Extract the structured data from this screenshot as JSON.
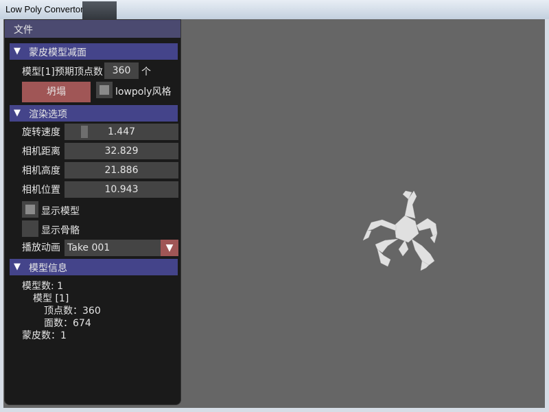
{
  "window": {
    "title": "Low Poly Convertor"
  },
  "menu": {
    "file": "文件"
  },
  "section_reduce": {
    "header": "蒙皮模型减面",
    "target_label": "模型[1]预期顶点数",
    "target_value": "360",
    "target_unit": "个",
    "collapse_button": "坍塌",
    "lowpoly_label": "lowpoly风格",
    "lowpoly_checked": true
  },
  "section_render": {
    "header": "渲染选项",
    "rotate_speed_label": "旋转速度",
    "rotate_speed_value": "1.447",
    "camera_distance_label": "相机距离",
    "camera_distance_value": "32.829",
    "camera_height_label": "相机高度",
    "camera_height_value": "21.886",
    "camera_position_label": "相机位置",
    "camera_position_value": "10.943",
    "show_model_label": "显示模型",
    "show_model_checked": true,
    "show_skeleton_label": "显示骨骼",
    "show_skeleton_checked": false,
    "play_anim_label": "播放动画",
    "play_anim_value": "Take 001"
  },
  "section_info": {
    "header": "模型信息",
    "model_count": "模型数: 1",
    "model_item": "模型 [1]",
    "vertex_count": "顶点数：360",
    "face_count": "面数：674",
    "skin_count": "蒙皮数：1"
  },
  "colors": {
    "panel_bg": "#1a1a1a",
    "header_bg": "#44448a",
    "button_accent": "#a05656",
    "viewport_bg": "#666666"
  }
}
